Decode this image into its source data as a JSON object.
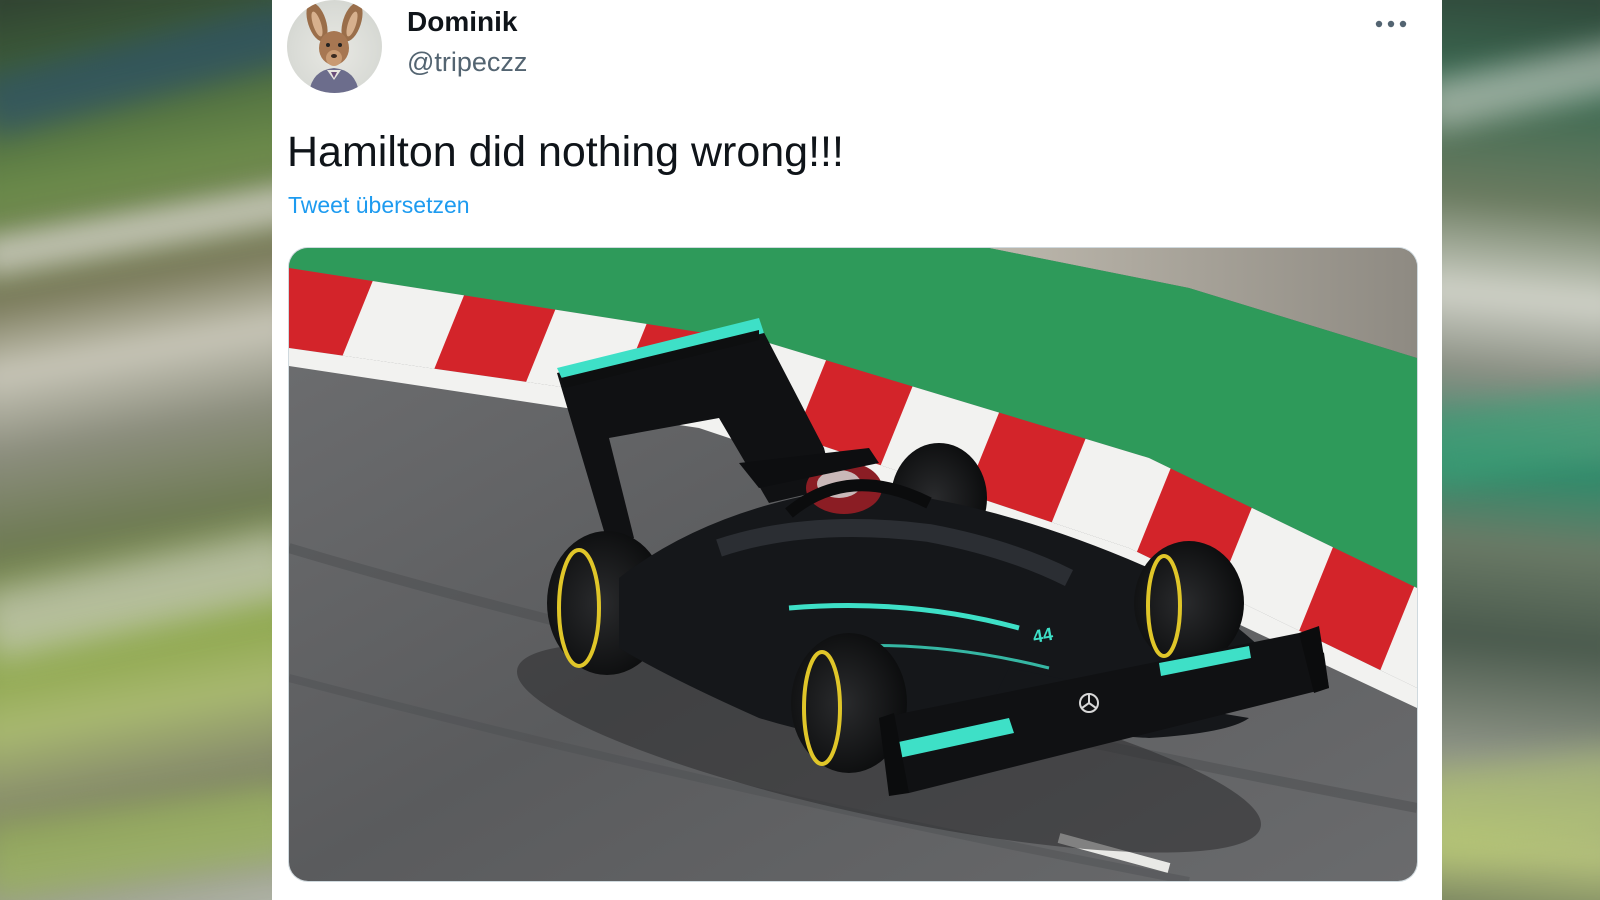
{
  "tweet": {
    "author_name": "Dominik",
    "author_handle": "@tripeczz",
    "text": "Hamilton did nothing wrong!!!",
    "translate_label": "Tweet übersetzen",
    "avatar_icon": "kangaroo-avatar-icon",
    "more_icon": "more-horizontal-icon"
  },
  "media": {
    "description_icon": "race-car-photo",
    "car_colors": {
      "body": "#15171a",
      "accent": "#3ee0c7",
      "track_green": "#2e9a5a",
      "kerb_red": "#d3242a"
    }
  },
  "colors": {
    "link": "#1d9bf0",
    "handle": "#536471",
    "text": "#0f1419",
    "card_bg": "#ffffff"
  }
}
